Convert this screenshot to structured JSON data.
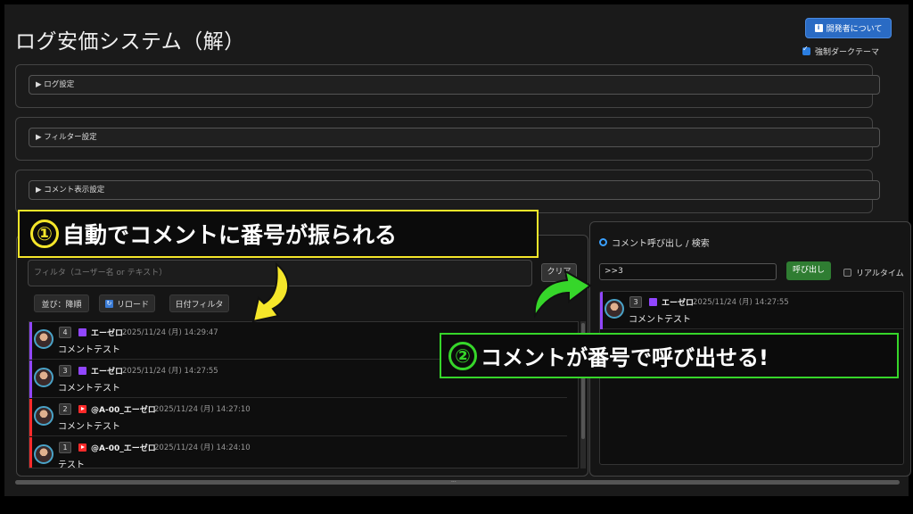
{
  "app": {
    "title": "ログ安価システム（解）",
    "dev_button": "開発者について",
    "dev_icon": "info-icon",
    "dark_theme_label": "強制ダークテーマ",
    "dark_theme_checked": true
  },
  "sections": [
    {
      "label": "▶ ログ設定"
    },
    {
      "label": "▶ フィルター設定"
    },
    {
      "label": "▶ コメント表示設定"
    }
  ],
  "left_panel": {
    "filter_placeholder": "フィルタ（ユーザー名 or テキスト）",
    "clear_label": "クリア",
    "sort_label": "並び：降順",
    "reload_label": "リロード",
    "date_filter_label": "日付フィルタ",
    "comments": [
      {
        "number": "4",
        "platform": "twitch",
        "user": "エーゼロ",
        "timestamp": "2025/11/24 (月) 14:29:47",
        "text": "コメントテスト"
      },
      {
        "number": "3",
        "platform": "twitch",
        "user": "エーゼロ",
        "timestamp": "2025/11/24 (月) 14:27:55",
        "text": "コメントテスト"
      },
      {
        "number": "2",
        "platform": "youtube",
        "user": "@A-00_エーゼロ",
        "timestamp": "2025/11/24 (月) 14:27:10",
        "text": "コメントテスト"
      },
      {
        "number": "1",
        "platform": "youtube",
        "user": "@A-00_エーゼロ",
        "timestamp": "2025/11/24 (月) 14:24:10",
        "text": "テスト"
      }
    ]
  },
  "right_panel": {
    "title": "コメント呼び出し / 検索",
    "search_value": ">>3",
    "call_button": "呼び出し",
    "realtime_label": "リアルタイム",
    "realtime_checked": false,
    "result": {
      "number": "3",
      "platform": "twitch",
      "user": "エーゼロ",
      "timestamp": "2025/11/24 (月) 14:27:55",
      "text": "コメントテスト"
    }
  },
  "callouts": {
    "one_number": "①",
    "one_text": "自動でコメントに番号が振られる",
    "two_number": "②",
    "two_text": "コメントが番号で呼び出せる!"
  },
  "colors": {
    "twitch": "#9146ff",
    "youtube": "#ff2a2a",
    "callout_one": "#f5e62a",
    "callout_two": "#36d62a",
    "accent_blue": "#2a6bc4",
    "call_green": "#2f7d32"
  }
}
